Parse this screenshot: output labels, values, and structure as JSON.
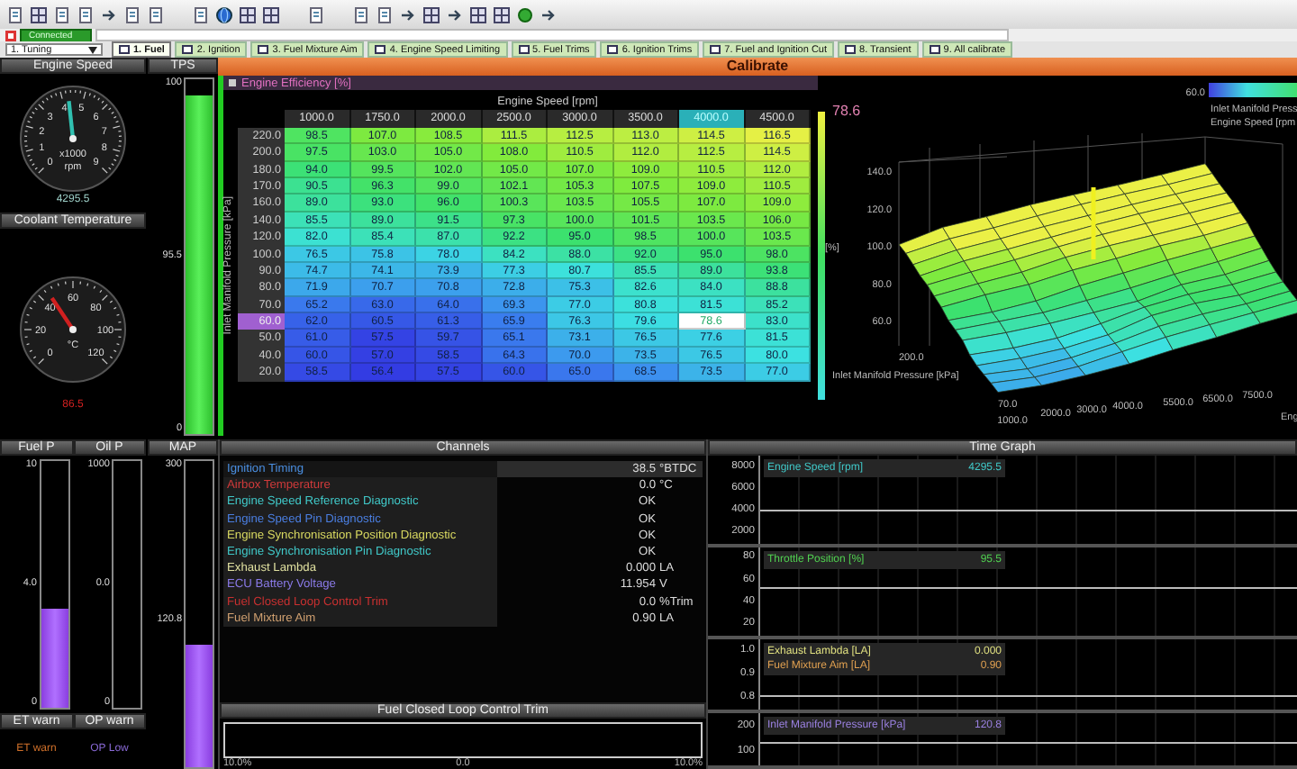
{
  "connection": {
    "label": "Connected"
  },
  "layout_selector": {
    "value": "1. Tuning"
  },
  "tabs": [
    {
      "label": "1. Fuel",
      "selected": true
    },
    {
      "label": "2. Ignition",
      "selected": false
    },
    {
      "label": "3. Fuel Mixture Aim",
      "selected": false
    },
    {
      "label": "4. Engine Speed Limiting",
      "selected": false
    },
    {
      "label": "5. Fuel Trims",
      "selected": false
    },
    {
      "label": "6. Ignition Trims",
      "selected": false
    },
    {
      "label": "7. Fuel and Ignition Cut",
      "selected": false
    },
    {
      "label": "8. Transient",
      "selected": false
    },
    {
      "label": "9. All calibrate",
      "selected": false
    }
  ],
  "engine_speed": {
    "title": "Engine Speed",
    "ticks": [
      "0",
      "1",
      "2",
      "3",
      "4",
      "5",
      "6",
      "7",
      "8",
      "9"
    ],
    "units": [
      "x1000",
      "rpm"
    ],
    "level": 0.477,
    "reading": "4295.5"
  },
  "coolant": {
    "title": "Coolant Temperature",
    "ticks": [
      "0",
      "20",
      "40",
      "60",
      "80",
      "100",
      "120"
    ],
    "units": [
      "°C"
    ],
    "level": 0.375,
    "reading": "86.5"
  },
  "tps": {
    "title": "TPS",
    "max": "100",
    "reading": "95.5",
    "min": "0",
    "level": 0.955
  },
  "calibrate": {
    "title": "Calibrate",
    "table": {
      "title": "Engine Efficiency [%]",
      "x_title": "Engine Speed [rpm]",
      "y_title": "Inlet Manifold Pressure [kPa]",
      "columns": [
        {
          "label": "1000.0",
          "selected": false
        },
        {
          "label": "1750.0",
          "selected": false
        },
        {
          "label": "2000.0",
          "selected": false
        },
        {
          "label": "2500.0",
          "selected": false
        },
        {
          "label": "3000.0",
          "selected": false
        },
        {
          "label": "3500.0",
          "selected": false
        },
        {
          "label": "4000.0",
          "selected": true
        },
        {
          "label": "4500.0",
          "selected": false
        }
      ],
      "rows": [
        {
          "label": "220.0",
          "selected": false,
          "cells": [
            "98.5",
            "107.0",
            "108.5",
            "111.5",
            "112.5",
            "113.0",
            "114.5",
            "116.5"
          ]
        },
        {
          "label": "200.0",
          "selected": false,
          "cells": [
            "97.5",
            "103.0",
            "105.0",
            "108.0",
            "110.5",
            "112.0",
            "112.5",
            "114.5"
          ]
        },
        {
          "label": "180.0",
          "selected": false,
          "cells": [
            "94.0",
            "99.5",
            "102.0",
            "105.0",
            "107.0",
            "109.0",
            "110.5",
            "112.0"
          ]
        },
        {
          "label": "170.0",
          "selected": false,
          "cells": [
            "90.5",
            "96.3",
            "99.0",
            "102.1",
            "105.3",
            "107.5",
            "109.0",
            "110.5"
          ]
        },
        {
          "label": "160.0",
          "selected": false,
          "cells": [
            "89.0",
            "93.0",
            "96.0",
            "100.3",
            "103.5",
            "105.5",
            "107.0",
            "109.0"
          ]
        },
        {
          "label": "140.0",
          "selected": false,
          "cells": [
            "85.5",
            "89.0",
            "91.5",
            "97.3",
            "100.0",
            "101.5",
            "103.5",
            "106.0"
          ]
        },
        {
          "label": "120.0",
          "selected": false,
          "cells": [
            "82.0",
            "85.4",
            "87.0",
            "92.2",
            "95.0",
            "98.5",
            "100.0",
            "103.5"
          ]
        },
        {
          "label": "100.0",
          "selected": false,
          "cells": [
            "76.5",
            "75.8",
            "78.0",
            "84.2",
            "88.0",
            "92.0",
            "95.0",
            "98.0"
          ]
        },
        {
          "label": "90.0",
          "selected": false,
          "cells": [
            "74.7",
            "74.1",
            "73.9",
            "77.3",
            "80.7",
            "85.5",
            "89.0",
            "93.8"
          ]
        },
        {
          "label": "80.0",
          "selected": false,
          "cells": [
            "71.9",
            "70.7",
            "70.8",
            "72.8",
            "75.3",
            "82.6",
            "84.0",
            "88.8"
          ]
        },
        {
          "label": "70.0",
          "selected": false,
          "cells": [
            "65.2",
            "63.0",
            "64.0",
            "69.3",
            "77.0",
            "80.8",
            "81.5",
            "85.2"
          ]
        },
        {
          "label": "60.0",
          "selected": true,
          "cells": [
            "62.0",
            "60.5",
            "61.3",
            "65.9",
            "76.3",
            "79.6",
            "78.6",
            "83.0"
          ]
        },
        {
          "label": "50.0",
          "selected": false,
          "cells": [
            "61.0",
            "57.5",
            "59.7",
            "65.1",
            "73.1",
            "76.5",
            "77.6",
            "81.5"
          ]
        },
        {
          "label": "40.0",
          "selected": false,
          "cells": [
            "60.0",
            "57.0",
            "58.5",
            "64.3",
            "70.0",
            "73.5",
            "76.5",
            "80.0"
          ]
        },
        {
          "label": "20.0",
          "selected": false,
          "cells": [
            "58.5",
            "56.4",
            "57.5",
            "60.0",
            "65.0",
            "68.5",
            "73.5",
            "77.0"
          ]
        }
      ]
    },
    "plot": {
      "value": "78.6",
      "legend_value": "60.0",
      "legend_labels": [
        "Inlet Manifold Press",
        "Engine Speed [rpm"
      ],
      "z_ticks": [
        "140.0",
        "120.0",
        "100.0",
        "80.0",
        "60.0"
      ],
      "z_label": "[%]",
      "y_ticks": [
        "200.0",
        "70.0"
      ],
      "y_label": "Inlet Manifold Pressure [kPa]",
      "x_ticks": [
        "1000.0",
        "2000.0",
        "3000.0",
        "4000.0",
        "5500.0",
        "6500.0",
        "7500.0"
      ],
      "x_label": "Eng"
    }
  },
  "fuel_p": {
    "title": "Fuel P",
    "max": "10",
    "reading": "4.0",
    "min": "0",
    "level": 0.4
  },
  "oil_p": {
    "title": "Oil P",
    "max": "1000",
    "reading": "0.0",
    "min": "0",
    "level": 0
  },
  "map": {
    "title": "MAP",
    "max": "300",
    "reading": "120.8",
    "level": 0.403
  },
  "warnings": [
    {
      "title": "ET warn",
      "text": "ET warn",
      "color": "#d0702a"
    },
    {
      "title": "OP warn",
      "text": "OP Low",
      "color": "#8a6ad8"
    }
  ],
  "channels": {
    "title": "Channels",
    "items": [
      {
        "name": "Ignition Timing",
        "value": "38.5",
        "unit": "°BTDC",
        "color": "#4a8ee0",
        "selected": true
      },
      {
        "name": "Airbox Temperature",
        "value": "0.0",
        "unit": "°C",
        "color": "#d03a3a",
        "selected": false
      },
      {
        "name": "Engine Speed Reference Diagnostic",
        "value": "OK",
        "color": "#40c8c8",
        "selected": false
      },
      {
        "name": "Engine Speed Pin Diagnostic",
        "value": "OK",
        "color": "#4a7ee0",
        "selected": false
      },
      {
        "name": "Engine Synchronisation Position Diagnostic",
        "value": "OK",
        "color": "#d8d860",
        "selected": false
      },
      {
        "name": "Engine Synchronisation Pin Diagnostic",
        "value": "OK",
        "color": "#40c8c8",
        "selected": false
      },
      {
        "name": "Exhaust Lambda",
        "value": "0.000",
        "unit": "LA",
        "color": "#e0e0a0",
        "selected": false
      },
      {
        "name": "ECU Battery Voltage",
        "value": "11.954",
        "unit": "V",
        "color": "#8a7ae8",
        "selected": false
      },
      {
        "name": "Fuel Closed Loop Control Trim",
        "value": "0.0",
        "unit": "%Trim",
        "color": "#c83030",
        "selected": false
      },
      {
        "name": "Fuel Mixture Aim",
        "value": "0.90",
        "unit": "LA",
        "color": "#d0a070",
        "selected": false
      }
    ]
  },
  "closed_loop": {
    "title": "Fuel Closed Loop Control Trim",
    "scale": [
      "10.0%",
      "0.0",
      "10.0%"
    ]
  },
  "time_graph": {
    "title": "Time Graph",
    "bands": [
      {
        "ticks": [
          "8000",
          "6000",
          "4000",
          "2000"
        ],
        "traces": [
          {
            "name": "Engine Speed [rpm]",
            "value": "4295.5",
            "color": "#40c8c8"
          }
        ]
      },
      {
        "ticks": [
          "80",
          "60",
          "40",
          "20"
        ],
        "traces": [
          {
            "name": "Throttle Position [%]",
            "value": "95.5",
            "color": "#50d050"
          }
        ]
      },
      {
        "ticks": [
          "1.0",
          "0.9",
          "0.8"
        ],
        "traces": [
          {
            "name": "Exhaust Lambda [LA]",
            "value": "0.000",
            "color": "#e0e080"
          },
          {
            "name": "Fuel Mixture Aim [LA]",
            "value": "0.90",
            "color": "#e0a050"
          }
        ]
      },
      {
        "ticks": [
          "200",
          "100"
        ],
        "traces": [
          {
            "name": "Inlet Manifold Pressure [kPa]",
            "value": "120.8",
            "color": "#9a80e0"
          }
        ]
      }
    ]
  }
}
